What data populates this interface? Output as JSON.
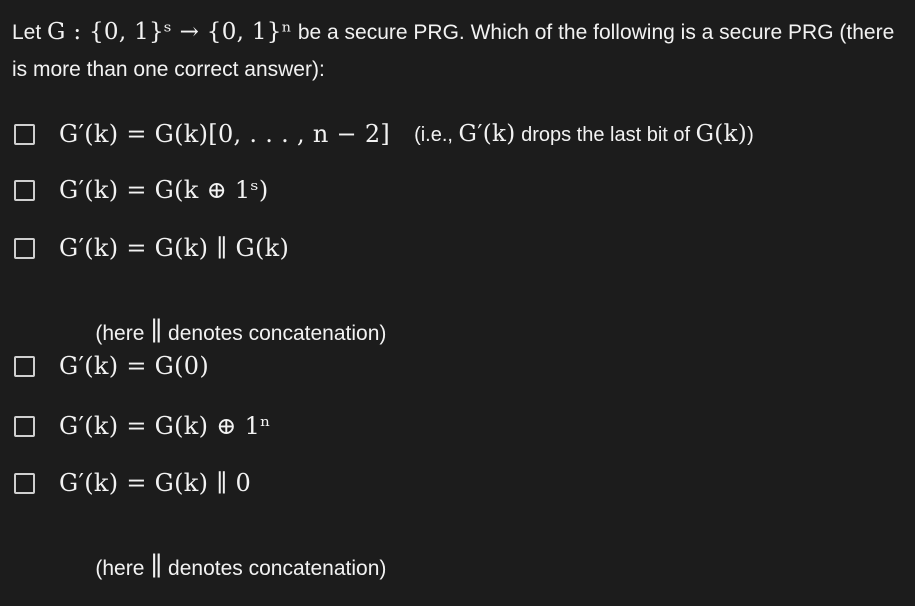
{
  "question": {
    "prefix": "Let ",
    "math": "G : {0, 1}ˢ → {0, 1}ⁿ",
    "suffix": " be a secure PRG. Which of the following is a secure PRG (there is more than one correct answer):"
  },
  "options": [
    {
      "math": "G′(k) = G(k)[0, . . . , n − 2]",
      "paren_open": "(i.e., ",
      "paren_math1": "G′(k)",
      "paren_mid": " drops the last bit of ",
      "paren_math2": "G(k)",
      "paren_close": ")"
    },
    {
      "math": "G′(k) = G(k ⊕ 1ˢ)"
    },
    {
      "math": "G′(k) = G(k) ∥ G(k)"
    },
    {
      "math": "G′(k) = G(0)"
    },
    {
      "math": "G′(k) = G(k) ⊕ 1ⁿ"
    },
    {
      "math": "G′(k) = G(k) ∥ 0"
    }
  ],
  "notes": [
    {
      "before": "(here ",
      "bar": "∥",
      "after": " denotes concatenation)"
    },
    {
      "before": "(here ",
      "bar": "∥",
      "after": " denotes concatenation)"
    }
  ]
}
